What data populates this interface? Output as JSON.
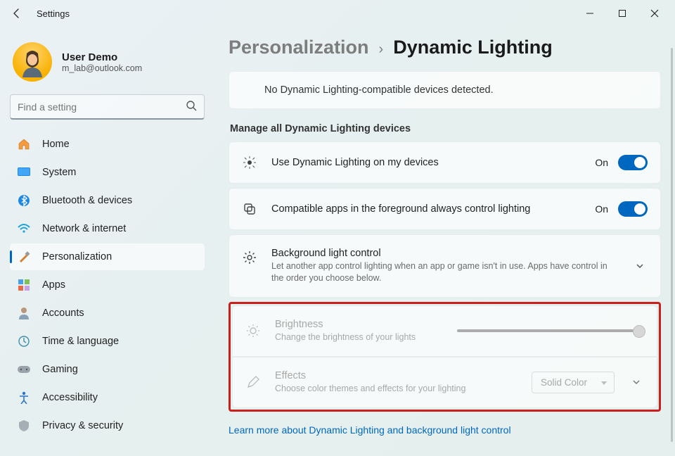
{
  "window": {
    "title": "Settings"
  },
  "user": {
    "name": "User Demo",
    "email": "m_lab@outlook.com"
  },
  "search": {
    "placeholder": "Find a setting"
  },
  "nav": {
    "home": "Home",
    "system": "System",
    "bluetooth": "Bluetooth & devices",
    "network": "Network & internet",
    "personalization": "Personalization",
    "apps": "Apps",
    "accounts": "Accounts",
    "time": "Time & language",
    "gaming": "Gaming",
    "accessibility": "Accessibility",
    "privacy": "Privacy & security"
  },
  "breadcrumb": {
    "parent": "Personalization",
    "current": "Dynamic Lighting"
  },
  "info": "No Dynamic Lighting-compatible devices detected.",
  "section_title": "Manage all Dynamic Lighting devices",
  "rows": {
    "use_dl": {
      "label": "Use Dynamic Lighting on my devices",
      "state": "On"
    },
    "compat": {
      "label": "Compatible apps in the foreground always control lighting",
      "state": "On"
    },
    "bg": {
      "label": "Background light control",
      "sub": "Let another app control lighting when an app or game isn't in use. Apps have control in the order you choose below."
    },
    "brightness": {
      "label": "Brightness",
      "sub": "Change the brightness of your lights",
      "value": 100
    },
    "effects": {
      "label": "Effects",
      "sub": "Choose color themes and effects for your lighting",
      "selected": "Solid Color"
    }
  },
  "learn_more": "Learn more about Dynamic Lighting and background light control"
}
